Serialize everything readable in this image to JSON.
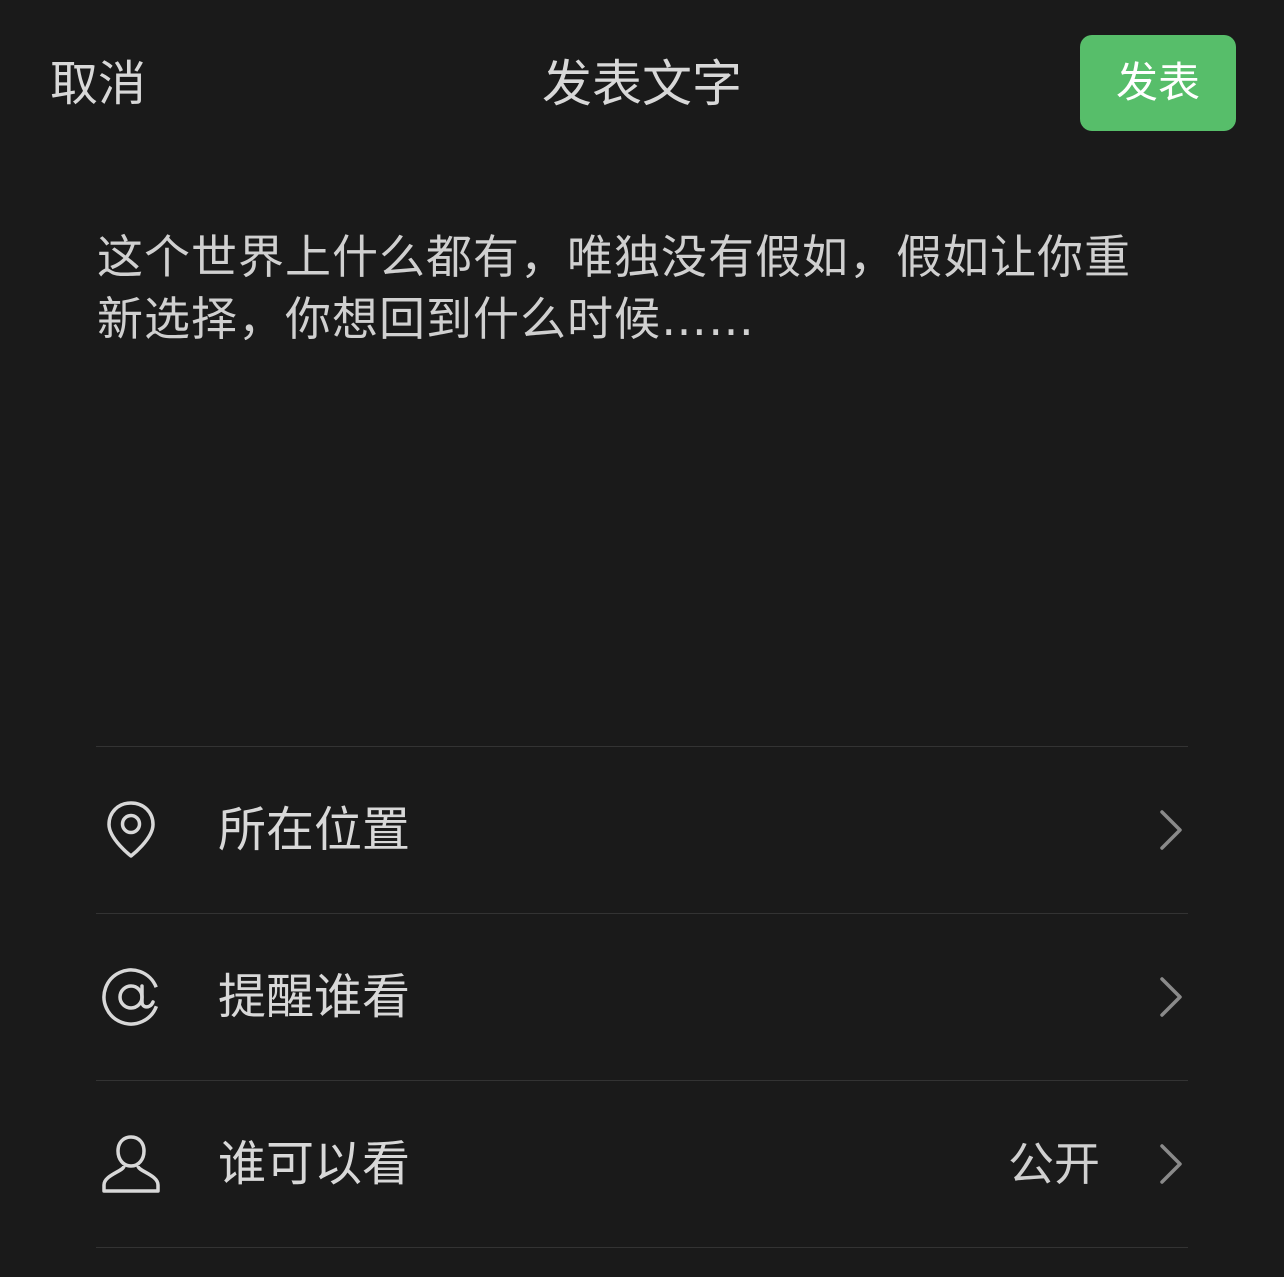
{
  "header": {
    "cancel_label": "取消",
    "title": "发表文字",
    "publish_label": "发表"
  },
  "composer": {
    "text": "这个世界上什么都有，唯独没有假如，假如让你重新选择，你想回到什么时候……"
  },
  "options": [
    {
      "icon": "location-pin-icon",
      "label": "所在位置",
      "value": ""
    },
    {
      "icon": "at-sign-icon",
      "label": "提醒谁看",
      "value": ""
    },
    {
      "icon": "person-icon",
      "label": "谁可以看",
      "value": "公开"
    }
  ],
  "colors": {
    "background": "#1a1a1a",
    "accent": "#57be6a",
    "divider": "#333333",
    "text": "#d8d8d8"
  }
}
